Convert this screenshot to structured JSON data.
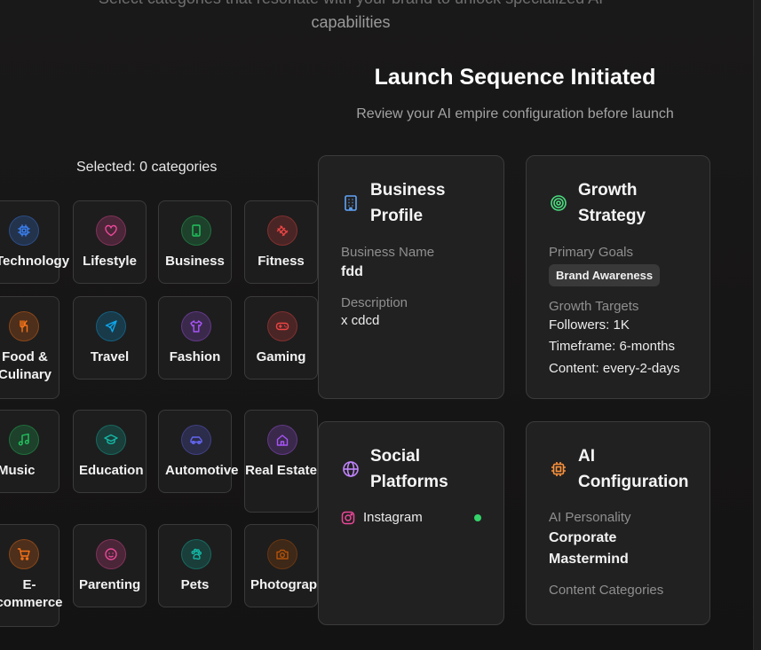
{
  "background": {
    "subtitle_line1": "Select categories that resonate with your brand to unlock specialized AI",
    "subtitle_line2": "capabilities",
    "selected_text": "Selected: 0 categories"
  },
  "categories": [
    {
      "label": "Technology",
      "icon": "cpu-icon",
      "color": "#3b82f6"
    },
    {
      "label": "Lifestyle",
      "icon": "heart-icon",
      "color": "#ec4899"
    },
    {
      "label": "Business",
      "icon": "tablet-icon",
      "color": "#22c55e"
    },
    {
      "label": "Fitness",
      "icon": "dumbbell-icon",
      "color": "#ef4444"
    },
    {
      "label": "Food & Culinary",
      "icon": "utensils-icon",
      "color": "#f97316"
    },
    {
      "label": "Travel",
      "icon": "plane-icon",
      "color": "#0ea5e9"
    },
    {
      "label": "Fashion",
      "icon": "shirt-icon",
      "color": "#a855f7"
    },
    {
      "label": "Gaming",
      "icon": "gamepad-icon",
      "color": "#ef4444"
    },
    {
      "label": "Music",
      "icon": "music-icon",
      "color": "#22c55e"
    },
    {
      "label": "Education",
      "icon": "graduation-cap-icon",
      "color": "#14b8a6"
    },
    {
      "label": "Automotive",
      "icon": "car-icon",
      "color": "#6366f1"
    },
    {
      "label": "Real Estate",
      "icon": "home-icon",
      "color": "#a855f7"
    },
    {
      "label": "E-commerce",
      "icon": "cart-icon",
      "color": "#f97316"
    },
    {
      "label": "Parenting",
      "icon": "baby-icon",
      "color": "#ec4899"
    },
    {
      "label": "Pets",
      "icon": "paw-icon",
      "color": "#14b8a6"
    },
    {
      "label": "Photography",
      "icon": "camera-icon",
      "color": "#b45309"
    }
  ],
  "launch": {
    "title": "Launch Sequence Initiated",
    "subtitle": "Review your AI empire configuration before launch"
  },
  "business_profile": {
    "title_line1": "Business",
    "title_line2": "Profile",
    "name_label": "Business Name",
    "name_value": "fdd",
    "description_label": "Description",
    "description_value": "x cdcd",
    "icon": "building-icon",
    "accent": "#60a5fa"
  },
  "growth_strategy": {
    "title_line1": "Growth",
    "title_line2": "Strategy",
    "goals_label": "Primary Goals",
    "goal_badge": "Brand Awareness",
    "targets_label": "Growth Targets",
    "followers": "Followers: 1K",
    "timeframe": "Timeframe: 6-months",
    "content": "Content: every-2-days",
    "icon": "target-icon",
    "accent": "#4ade80"
  },
  "social_platforms": {
    "title_line1": "Social",
    "title_line2": "Platforms",
    "platform": "Instagram",
    "icon": "globe-icon",
    "accent": "#c084fc",
    "status_color": "#34d36a"
  },
  "ai_configuration": {
    "title_line1": "AI",
    "title_line2": "Configuration",
    "personality_label": "AI Personality",
    "personality_line1": "Corporate",
    "personality_line2": "Mastermind",
    "categories_label": "Content Categories",
    "icon": "chip-icon",
    "accent": "#fb923c"
  }
}
